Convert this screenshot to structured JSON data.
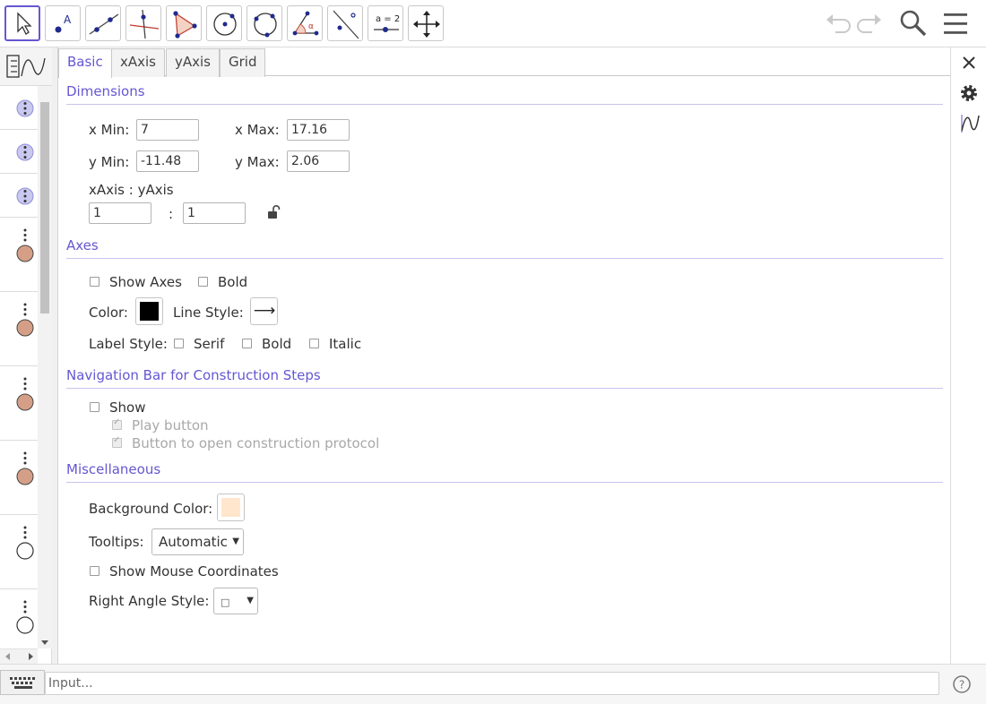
{
  "toolbar": {
    "tools": [
      {
        "name": "move-tool",
        "icon": "arrow-cursor-icon",
        "selected": true
      },
      {
        "name": "point-tool",
        "icon": "point-icon",
        "label": "A"
      },
      {
        "name": "line-tool",
        "icon": "line-through-points-icon"
      },
      {
        "name": "perpendicular-tool",
        "icon": "perpendicular-line-icon"
      },
      {
        "name": "polygon-tool",
        "icon": "polygon-icon"
      },
      {
        "name": "circle-center-point-tool",
        "icon": "circle-center-icon"
      },
      {
        "name": "circle-three-points-tool",
        "icon": "circle-three-points-icon"
      },
      {
        "name": "angle-tool",
        "icon": "angle-icon",
        "label": "α"
      },
      {
        "name": "reflect-tool",
        "icon": "reflect-line-icon"
      },
      {
        "name": "slider-tool",
        "icon": "slider-icon",
        "label": "a = 2"
      },
      {
        "name": "move-graphics-tool",
        "icon": "move-view-icon"
      }
    ],
    "right_icons": [
      "undo-icon",
      "redo-icon",
      "search-icon",
      "menu-icon"
    ]
  },
  "algebra": {
    "header_icon": "algebra-graphics-toggle-icon",
    "rows": [
      {
        "marker": "dots-menu",
        "color": "#c8c8f0"
      },
      {
        "marker": "dots-menu",
        "color": "#c8c8f0"
      },
      {
        "marker": "dots-menu",
        "color": "#c8c8f0"
      },
      {
        "marker": "visibility-circle",
        "color": "#d59f87"
      },
      {
        "marker": "visibility-circle",
        "color": "#d59f87"
      },
      {
        "marker": "visibility-circle",
        "color": "#d59f87"
      },
      {
        "marker": "visibility-circle",
        "color": "#d59f87"
      },
      {
        "marker": "visibility-circle",
        "color": "#ffffff"
      },
      {
        "marker": "visibility-circle",
        "color": "#ffffff"
      }
    ]
  },
  "settings": {
    "tabs": [
      {
        "label": "Basic",
        "active": true
      },
      {
        "label": "xAxis",
        "active": false
      },
      {
        "label": "yAxis",
        "active": false
      },
      {
        "label": "Grid",
        "active": false
      }
    ],
    "dimensions": {
      "title": "Dimensions",
      "x_min_label": "x Min:",
      "x_min_value": "7",
      "x_max_label": "x Max:",
      "x_max_value": "17.16",
      "y_min_label": "y Min:",
      "y_min_value": "-11.48",
      "y_max_label": "y Max:",
      "y_max_value": "2.06",
      "ratio_label": "xAxis : yAxis",
      "ratio_x": "1",
      "ratio_sep": ":",
      "ratio_y": "1",
      "lock_icon": "unlocked-padlock-icon"
    },
    "axes": {
      "title": "Axes",
      "show_axes_label": "Show Axes",
      "show_axes_checked": false,
      "bold_label": "Bold",
      "bold_checked": false,
      "color_label": "Color:",
      "color_value": "#000000",
      "line_style_label": "Line Style:",
      "line_style_glyph": "⟶",
      "label_style_label": "Label Style:",
      "serif_label": "Serif",
      "serif_checked": false,
      "label_bold_label": "Bold",
      "label_bold_checked": false,
      "italic_label": "Italic",
      "italic_checked": false
    },
    "navigation": {
      "title": "Navigation Bar for Construction Steps",
      "show_label": "Show",
      "show_checked": false,
      "play_button_label": "Play button",
      "play_button_checked": true,
      "protocol_button_label": "Button to open construction protocol",
      "protocol_button_checked": true
    },
    "misc": {
      "title": "Miscellaneous",
      "background_color_label": "Background Color:",
      "background_color": "#ffe6cc",
      "tooltips_label": "Tooltips:",
      "tooltips_value": "Automatic",
      "show_mouse_coords_label": "Show Mouse Coordinates",
      "show_mouse_coords_checked": false,
      "right_angle_label": "Right Angle Style:",
      "right_angle_value": "□"
    }
  },
  "right_sidebar": {
    "icons": [
      "close-icon",
      "gear-icon",
      "graphics-view-icon"
    ]
  },
  "input_bar": {
    "placeholder": "Input...",
    "keyboard_icon": "keyboard-icon",
    "help_icon": "help-icon"
  }
}
